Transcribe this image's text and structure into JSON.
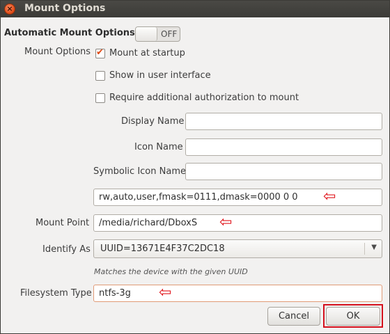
{
  "window": {
    "title": "Mount Options",
    "close_glyph": "×"
  },
  "automatic": {
    "label": "Automatic Mount Options",
    "toggle_state": "OFF",
    "toggle_on": false
  },
  "mount_options": {
    "label": "Mount Options",
    "checkboxes": [
      {
        "label": "Mount at startup",
        "checked": true
      },
      {
        "label": "Show in user interface",
        "checked": false
      },
      {
        "label": "Require additional authorization to mount",
        "checked": false
      }
    ],
    "display_name": {
      "label": "Display Name",
      "value": ""
    },
    "icon_name": {
      "label": "Icon Name",
      "value": ""
    },
    "symbolic_icon_name": {
      "label": "Symbolic Icon Name",
      "value": ""
    },
    "options_value": "rw,auto,user,fmask=0111,dmask=0000  0   0"
  },
  "mount_point": {
    "label": "Mount Point",
    "value": "/media/richard/DboxS"
  },
  "identify_as": {
    "label": "Identify As",
    "value": "UUID=13671E4F37C2DC18",
    "hint": "Matches the device with the given UUID"
  },
  "filesystem_type": {
    "label": "Filesystem Type",
    "value": "ntfs-3g"
  },
  "buttons": {
    "cancel": "Cancel",
    "ok": "OK"
  },
  "annotation_arrow": "⇦",
  "colors": {
    "accent": "#dd4814",
    "annotation": "#e0141b",
    "titlebar": "#3c3b37"
  }
}
